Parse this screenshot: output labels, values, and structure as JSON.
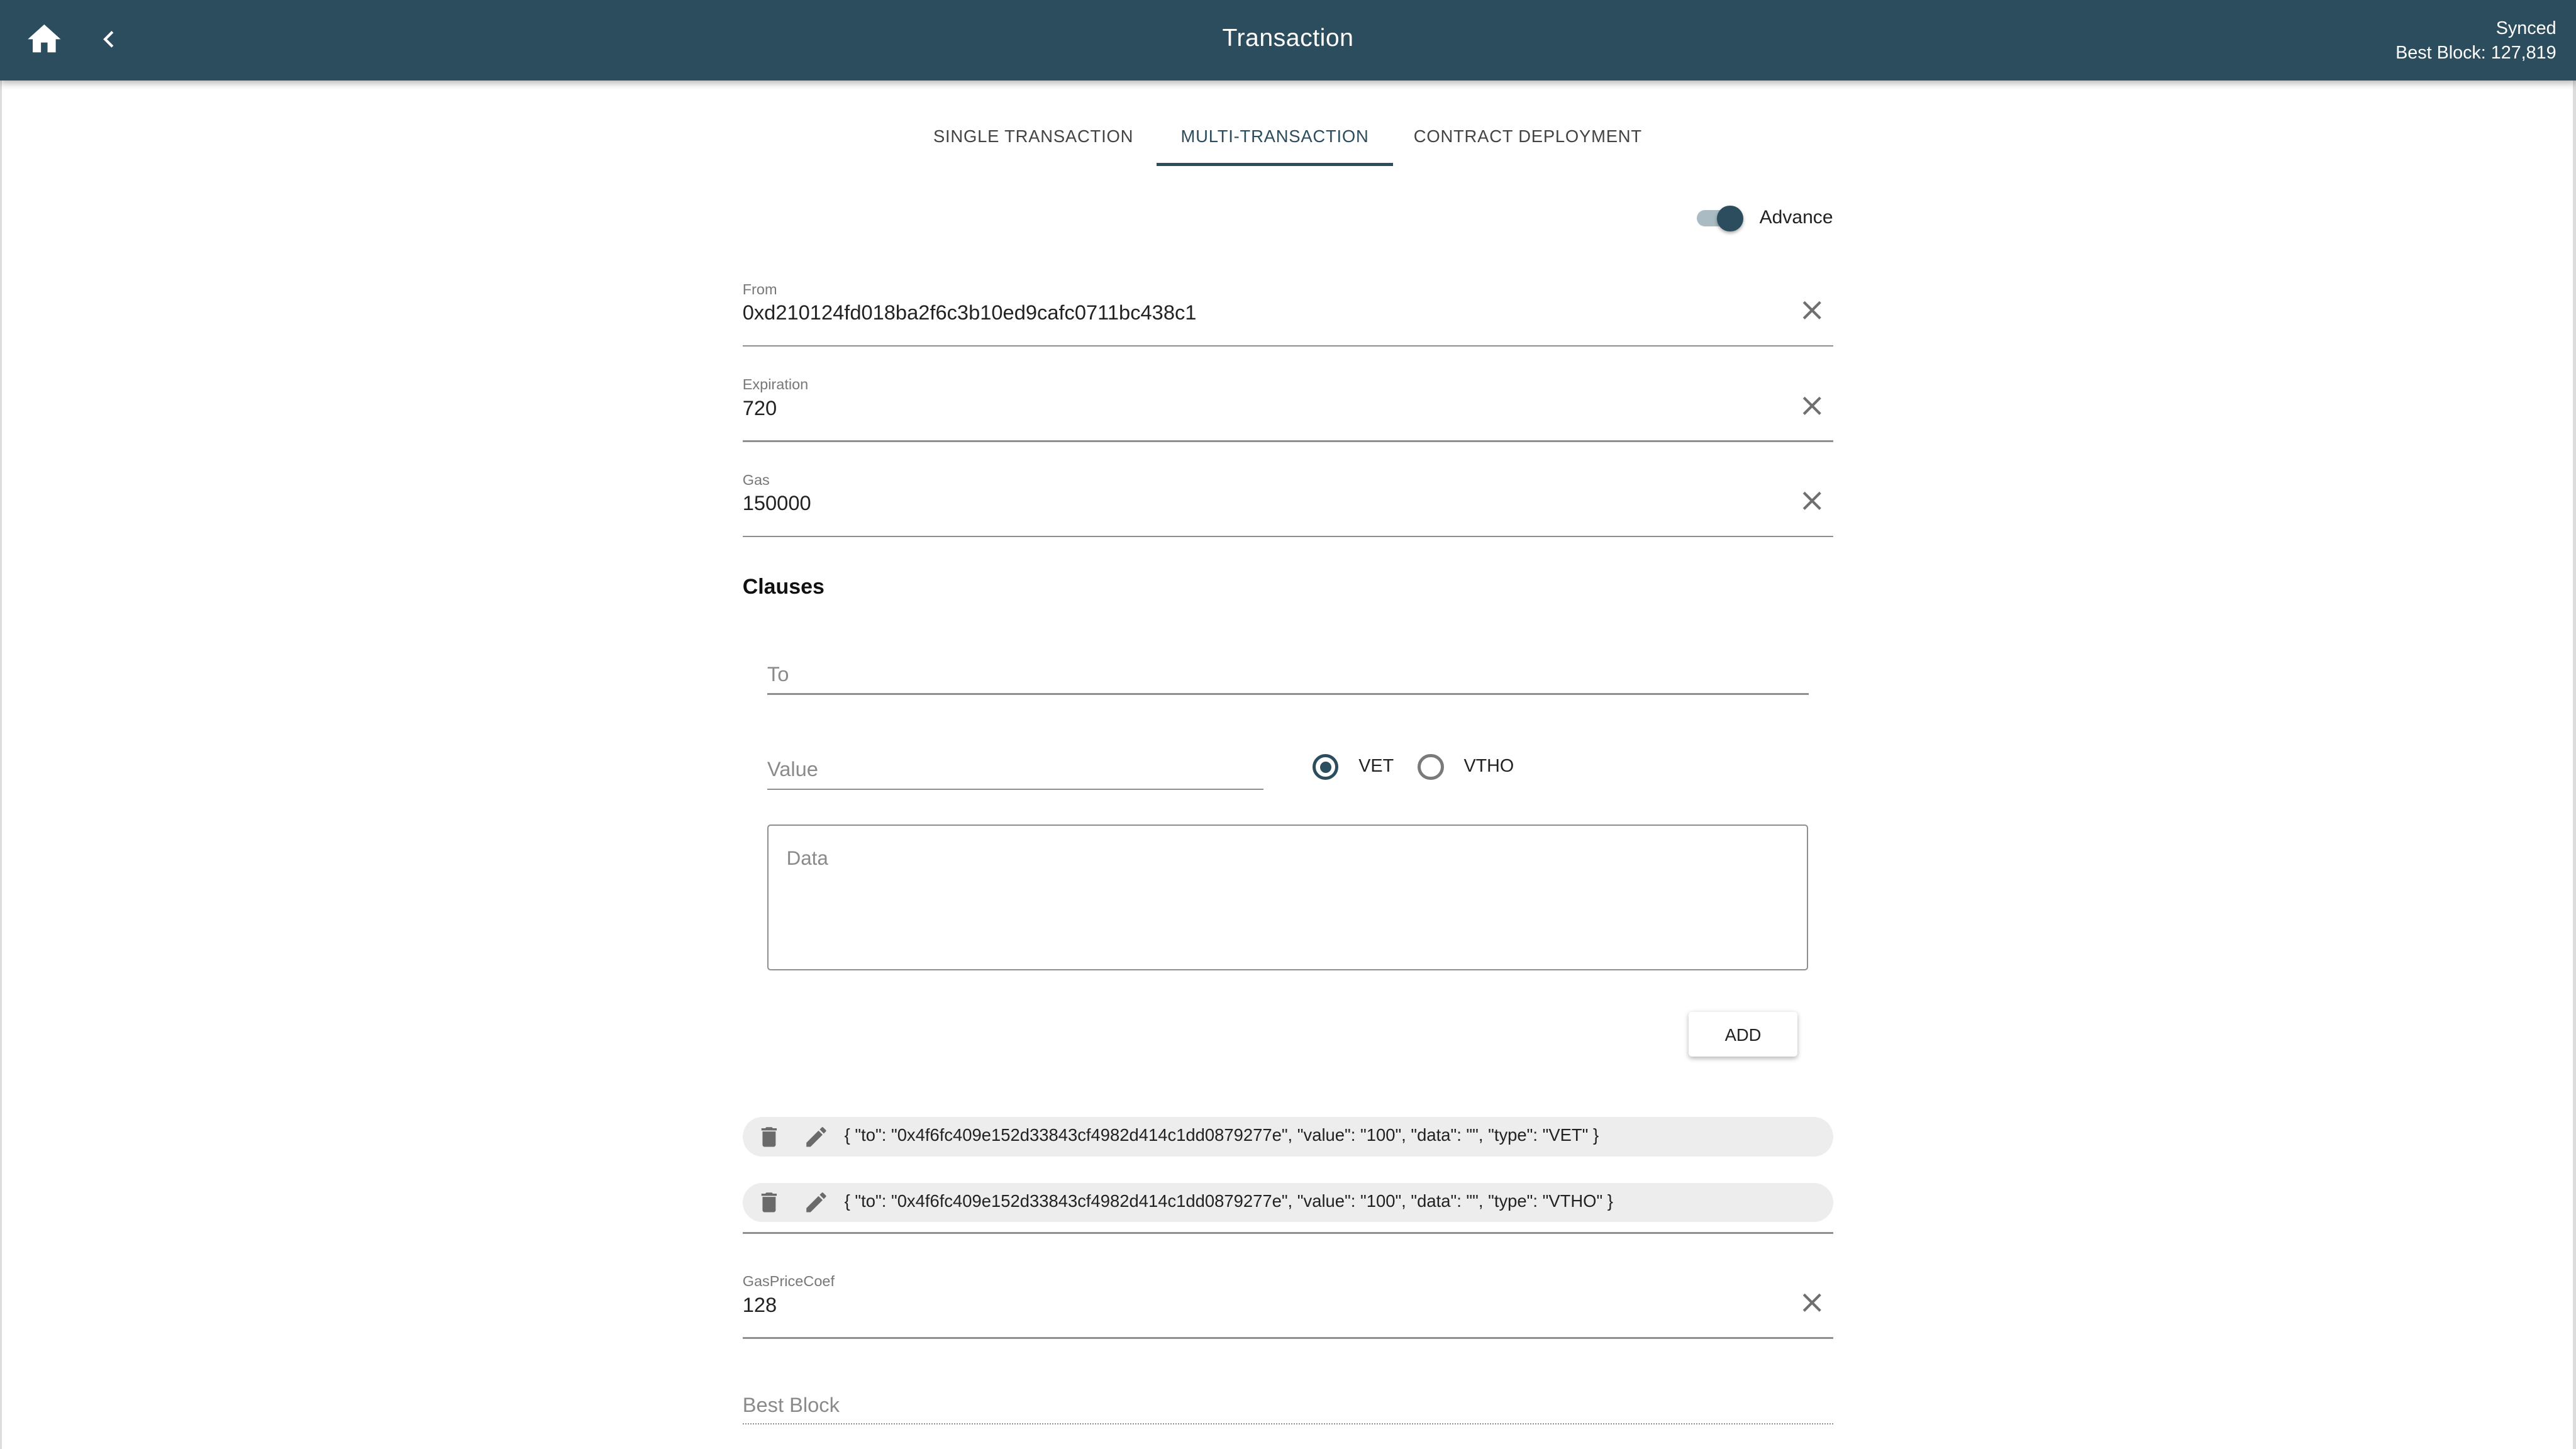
{
  "header": {
    "title": "Transaction",
    "status": "Synced",
    "best_block": "Best Block: 127,819",
    "home_icon": "home-icon",
    "back_icon": "chevron-left-icon"
  },
  "tabs": [
    {
      "label": "Single Transaction",
      "active": false
    },
    {
      "label": "Multi-Transaction",
      "active": true
    },
    {
      "label": "Contract Deployment",
      "active": false
    }
  ],
  "advance_toggle": {
    "label": "Advance",
    "on": true
  },
  "fields": {
    "from": {
      "label": "From",
      "value": "0xd210124fd018ba2f6c3b10ed9cafc0711bc438c1"
    },
    "expiration": {
      "label": "Expiration",
      "value": "720"
    },
    "gas": {
      "label": "Gas",
      "value": "150000"
    },
    "gas_price_coef": {
      "label": "GasPriceCoef",
      "value": "128"
    },
    "best_block": {
      "placeholder": "Best Block"
    }
  },
  "clauses": {
    "title": "Clauses",
    "to_placeholder": "To",
    "value_placeholder": "Value",
    "token_options": [
      {
        "label": "VET",
        "selected": true
      },
      {
        "label": "VTHO",
        "selected": false
      }
    ],
    "data_placeholder": "Data",
    "add_label": "ADD",
    "list": [
      "{ \"to\": \"0x4f6fc409e152d33843cf4982d414c1dd0879277e\", \"value\": \"100\", \"data\": \"\", \"type\": \"VET\" }",
      "{ \"to\": \"0x4f6fc409e152d33843cf4982d414c1dd0879277e\", \"value\": \"100\", \"data\": \"\", \"type\": \"VTHO\" }"
    ]
  },
  "colors": {
    "primary": "#2c4d5e",
    "toggle_track": "#aabbc3",
    "chip_bg": "#ededed"
  }
}
